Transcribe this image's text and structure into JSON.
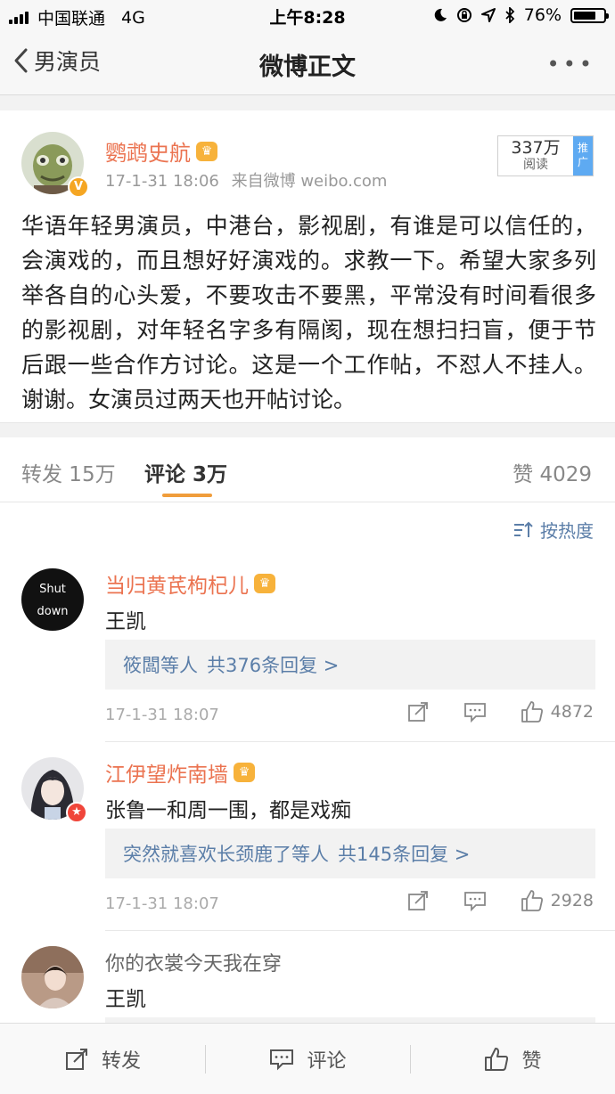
{
  "status_bar": {
    "carrier": "中国联通",
    "network": "4G",
    "time": "上午8:28",
    "battery": "76%",
    "battery_level": 0.76
  },
  "nav": {
    "back_label": "男演员",
    "title": "微博正文",
    "more_label": "•••"
  },
  "post": {
    "author": "鹦鹉史航",
    "avatar_badge": "V",
    "time": "17-1-31 18:06",
    "source": "来自微博 weibo.com",
    "reads_count": "337万",
    "reads_label": "阅读",
    "promote_label": "推广",
    "text": "华语年轻男演员，中港台，影视剧，有谁是可以信任的，会演戏的，而且想好好演戏的。求教一下。希望大家多列举各自的心头爱，不要攻击不要黑，平常没有时间看很多的影视剧，对年轻名字多有隔阂，现在想扫扫盲，便于节后跟一些合作方讨论。这是一个工作帖，不怼人不挂人。谢谢。女演员过两天也开帖讨论。"
  },
  "tabs": {
    "repost": "转发 15万",
    "comment": "评论 3万",
    "like": "赞 4029"
  },
  "sort_label": "按热度",
  "comments": [
    {
      "name": "当归黄芪枸杞儿",
      "avatar_text_1": "Shut",
      "avatar_text_2": "down",
      "text": "王凯",
      "reply_who": "筱闆等人",
      "reply_count": "共376条回复 >",
      "time": "17-1-31 18:07",
      "likes": "4872"
    },
    {
      "name": "江伊望炸南墙",
      "text": "张鲁一和周一围，都是戏痴",
      "reply_who": "突然就喜欢长颈鹿了等人",
      "reply_count": "共145条回复 >",
      "time": "17-1-31 18:07",
      "likes": "2928"
    },
    {
      "name": "你的衣裳今天我在穿",
      "text": "王凯"
    }
  ],
  "toolbar": {
    "repost": "转发",
    "comment": "评论",
    "like": "赞"
  },
  "colors": {
    "accent_orange": "#eb7350",
    "link_blue": "#5b7ea8",
    "tab_underline": "#f09d3b"
  }
}
